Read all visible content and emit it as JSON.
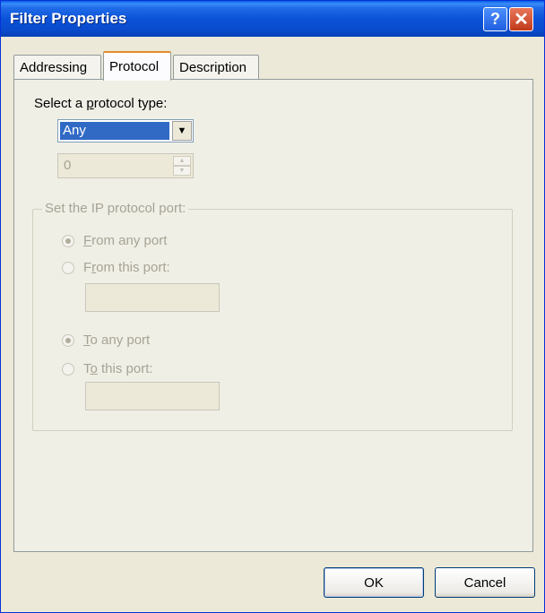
{
  "window": {
    "title": "Filter Properties"
  },
  "tabs": [
    {
      "label": "Addressing"
    },
    {
      "label": "Protocol"
    },
    {
      "label": "Description"
    }
  ],
  "protocol": {
    "select_label_pre": "Select a ",
    "select_label_accel": "p",
    "select_label_post": "rotocol type:",
    "protocol_type": "Any",
    "protocol_number": "0"
  },
  "port_group": {
    "legend": "Set the IP protocol port:",
    "from_any": {
      "accel": "F",
      "rest": "rom any port",
      "checked": true
    },
    "from_this": {
      "pre": "F",
      "accel": "r",
      "rest": "om this port:",
      "checked": false,
      "value": ""
    },
    "to_any": {
      "accel": "T",
      "rest": "o any port",
      "checked": true
    },
    "to_this": {
      "pre": "T",
      "accel": "o",
      "rest": " this port:",
      "checked": false,
      "value": ""
    }
  },
  "buttons": {
    "ok": "OK",
    "cancel": "Cancel"
  }
}
